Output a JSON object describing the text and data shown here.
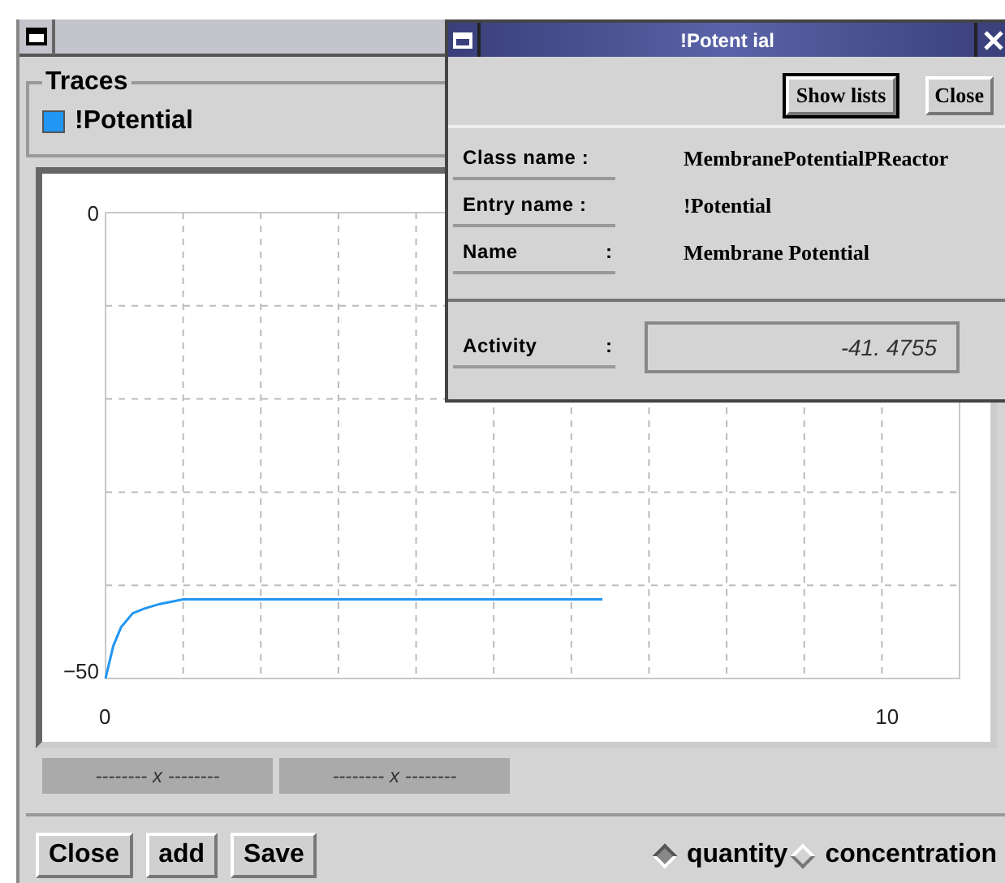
{
  "main_window": {
    "traces": {
      "title": "Traces",
      "items": [
        {
          "label": "!Potential",
          "color": "#2196f3"
        }
      ]
    },
    "plot": {
      "chart_data": {
        "type": "line",
        "x": [
          0,
          0.1,
          0.2,
          0.35,
          0.5,
          0.7,
          1.0,
          1.5,
          6.4
        ],
        "xlim": [
          0,
          11
        ],
        "ylim": [
          -50,
          0
        ],
        "xticks": [
          0,
          10
        ],
        "yticks": [
          -50,
          0
        ],
        "series": [
          {
            "color": "#2196f3",
            "values": [
              -50,
              -46.5,
              -44.5,
              -43,
              -42.5,
              -42,
              -41.5,
              -41.5,
              -41.5
            ]
          }
        ]
      }
    },
    "axis_fields": [
      "-------- x --------",
      "-------- x --------"
    ],
    "buttons": [
      "Close",
      "add",
      "Save"
    ],
    "modes": [
      {
        "label": "quantity",
        "selected": true
      },
      {
        "label": "concentration",
        "selected": false
      }
    ]
  },
  "popup": {
    "title": "!Potent ial",
    "buttons": [
      "Show lists",
      "Close"
    ],
    "properties": [
      {
        "label": "Class name :",
        "value": "MembranePotentialPReactor"
      },
      {
        "label": "Entry name :",
        "value": "!Potential"
      },
      {
        "label": "Name",
        "colon": ":",
        "value": "Membrane Potential"
      }
    ],
    "activity": {
      "label": "Activity",
      "colon": ":",
      "value": "-41. 4755"
    }
  }
}
